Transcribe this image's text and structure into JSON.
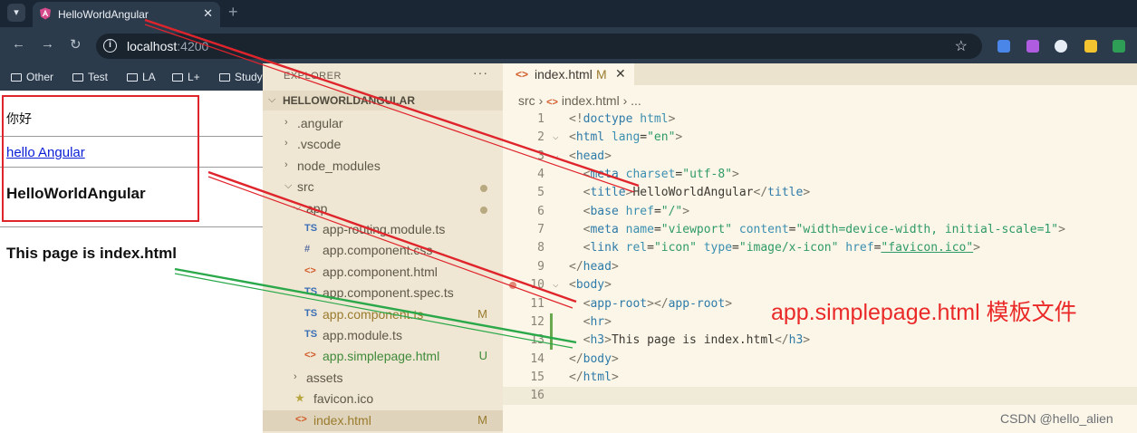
{
  "browser": {
    "tab_title": "HelloWorldAngular",
    "tab_close": "✕",
    "new_tab": "+",
    "url_host": "localhost",
    "url_port": ":4200",
    "bookmarks": [
      "Other",
      "Test",
      "LA",
      "L+",
      "Study"
    ]
  },
  "page": {
    "paragraph": "你好",
    "link": "hello Angular",
    "heading": "HelloWorldAngular",
    "index_heading": "This page is index.html"
  },
  "explorer": {
    "header": "EXPLORER",
    "more": "···",
    "root": "HELLOWORLDANGULAR",
    "items": [
      {
        "label": ".angular",
        "kind": "folder-closed",
        "indent": 1
      },
      {
        "label": ".vscode",
        "kind": "folder-closed",
        "indent": 1
      },
      {
        "label": "node_modules",
        "kind": "folder-closed",
        "indent": 1
      },
      {
        "label": "src",
        "kind": "folder-open",
        "indent": 1,
        "dot": true
      },
      {
        "label": "app",
        "kind": "folder-open",
        "indent": 2,
        "dot": true
      },
      {
        "label": "app-routing.module.ts",
        "kind": "ts",
        "indent": 3
      },
      {
        "label": "app.component.css",
        "kind": "css",
        "indent": 3
      },
      {
        "label": "app.component.html",
        "kind": "html",
        "indent": 3
      },
      {
        "label": "app.component.spec.ts",
        "kind": "ts",
        "indent": 3
      },
      {
        "label": "app.component.ts",
        "kind": "ts",
        "indent": 3,
        "badge": "M",
        "color": "#9a7b2e"
      },
      {
        "label": "app.module.ts",
        "kind": "ts",
        "indent": 3
      },
      {
        "label": "app.simplepage.html",
        "kind": "html",
        "indent": 3,
        "badge": "U",
        "color": "#3f8a3a"
      },
      {
        "label": "assets",
        "kind": "folder-closed",
        "indent": 2
      },
      {
        "label": "favicon.ico",
        "kind": "star",
        "indent": 2
      },
      {
        "label": "index.html",
        "kind": "html",
        "indent": 2,
        "badge": "M",
        "color": "#9a7b2e",
        "selected": true
      }
    ]
  },
  "editor": {
    "tab_title": "index.html",
    "tab_modified": "M",
    "tab_close": "✕",
    "breadcrumb": [
      "src",
      "index.html",
      "..."
    ],
    "lines": [
      {
        "n": "1",
        "code": "<!doctype html>"
      },
      {
        "n": "2",
        "code": "<html lang=\"en\">",
        "fold": true
      },
      {
        "n": "3",
        "code": "<head>",
        "fold": true
      },
      {
        "n": "4",
        "code": "  <meta charset=\"utf-8\">"
      },
      {
        "n": "5",
        "code": "  <title>HelloWorldAngular</title>"
      },
      {
        "n": "6",
        "code": "  <base href=\"/\">"
      },
      {
        "n": "7",
        "code": "  <meta name=\"viewport\" content=\"width=device-width, initial-scale=1\">"
      },
      {
        "n": "8",
        "code": "  <link rel=\"icon\" type=\"image/x-icon\" href=\"favicon.ico\">"
      },
      {
        "n": "9",
        "code": "</head>"
      },
      {
        "n": "10",
        "code": "<body>",
        "fold": true,
        "breakpoint": true
      },
      {
        "n": "11",
        "code": "  <app-root></app-root>"
      },
      {
        "n": "12",
        "code": "  <hr>",
        "changed": true
      },
      {
        "n": "13",
        "code": "  <h3>This page is index.html</h3>",
        "changed": true
      },
      {
        "n": "14",
        "code": "</body>"
      },
      {
        "n": "15",
        "code": "</html>"
      },
      {
        "n": "16",
        "code": "",
        "current": true
      }
    ]
  },
  "annotation": "app.simplepage.html 模板文件",
  "watermark": "CSDN @hello_alien",
  "colors": {
    "annotation_red": "#e0242c",
    "arrow_green": "#2aa84a",
    "chrome_bg": "#2c3b4c",
    "explorer_bg": "#efe7d3",
    "editor_bg": "#fbf6e8"
  }
}
